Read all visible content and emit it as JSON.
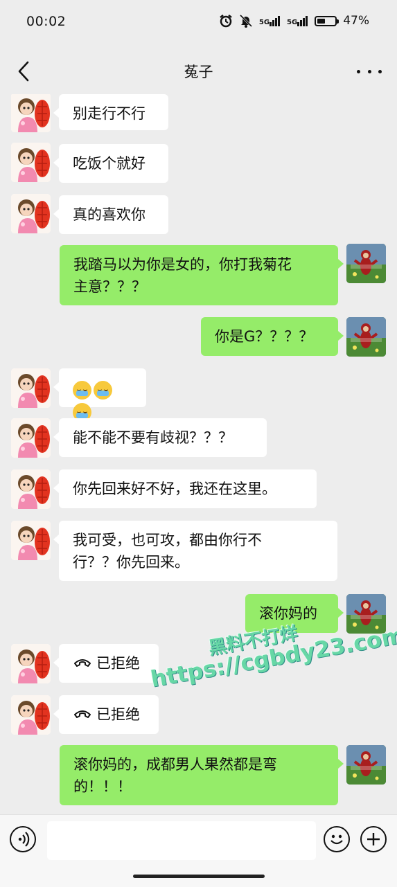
{
  "status_bar": {
    "time": "00:02",
    "network1": "5G",
    "network2": "5G",
    "battery": "47%",
    "battery_level": 0.47
  },
  "header": {
    "title": "菟子"
  },
  "watermark": {
    "line1": "黑料不打烊",
    "line2": "https://cgbdy23.com"
  },
  "messages": [
    {
      "sender": "her",
      "text": "别走行不行"
    },
    {
      "sender": "her",
      "text": "吃饭个就好"
    },
    {
      "sender": "her",
      "text": "真的喜欢你"
    },
    {
      "sender": "me",
      "text": "我踏马以为你是女的，你打我菊花\n主意？？？"
    },
    {
      "sender": "me",
      "text": "你是G？？？？"
    },
    {
      "sender": "her",
      "type": "emoji",
      "emoji_count": 3,
      "emoji_name": "crying-laughing-emoji"
    },
    {
      "sender": "her",
      "text": "能不能不要有歧视？？？"
    },
    {
      "sender": "her",
      "text": "你先回来好不好，我还在这里。"
    },
    {
      "sender": "her",
      "text": "我可受，也可攻，都由你行不\n行？？你先回来。"
    },
    {
      "sender": "me",
      "text": "滚你妈的"
    },
    {
      "sender": "her",
      "type": "call",
      "text": "已拒绝",
      "icon": "phone-declined-icon"
    },
    {
      "sender": "her",
      "type": "call",
      "text": "已拒绝",
      "icon": "phone-declined-icon"
    },
    {
      "sender": "me",
      "text": "滚你妈的，成都男人果然都是弯\n的！！！"
    }
  ],
  "input": {
    "value": ""
  }
}
